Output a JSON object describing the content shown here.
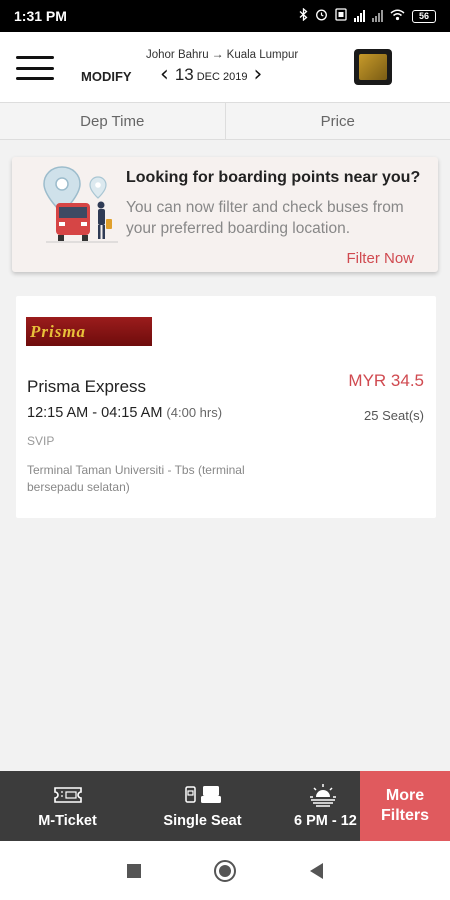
{
  "status_bar": {
    "time": "1:31 PM",
    "battery": "56"
  },
  "header": {
    "modify_label": "MODIFY",
    "from": "Johor Bahru",
    "to": "Kuala Lumpur",
    "date_day": "13",
    "date_month_year": "DEC 2019"
  },
  "sort": {
    "tabs": [
      {
        "label": "Dep Time"
      },
      {
        "label": "Price"
      }
    ]
  },
  "banner": {
    "title": "Looking for boarding points near you?",
    "description": "You can now filter and check buses from your preferred boarding location.",
    "action": "Filter Now"
  },
  "results": [
    {
      "operator_logo_text": "Prisma",
      "operator_name": "Prisma Express",
      "price": "MYR 34.5",
      "time_range": "12:15 AM - 04:15 AM",
      "duration": "(4:00 hrs)",
      "seats": "25 Seat(s)",
      "bus_type": "SVIP",
      "boarding_point": "Terminal Taman Universiti - Tbs (terminal bersepadu selatan)"
    }
  ],
  "bottom_filters": {
    "items": [
      {
        "label": "M-Ticket",
        "icon": "ticket-icon"
      },
      {
        "label": "Single Seat",
        "icon": "single-seat-icon"
      },
      {
        "label": "6 PM - 12",
        "icon": "sunset-icon"
      }
    ],
    "more_label": "More Filters"
  },
  "colors": {
    "accent": "#d04a50",
    "more_filters_bg": "#e05a5e",
    "bottom_bar_bg": "#3c3c3c"
  }
}
